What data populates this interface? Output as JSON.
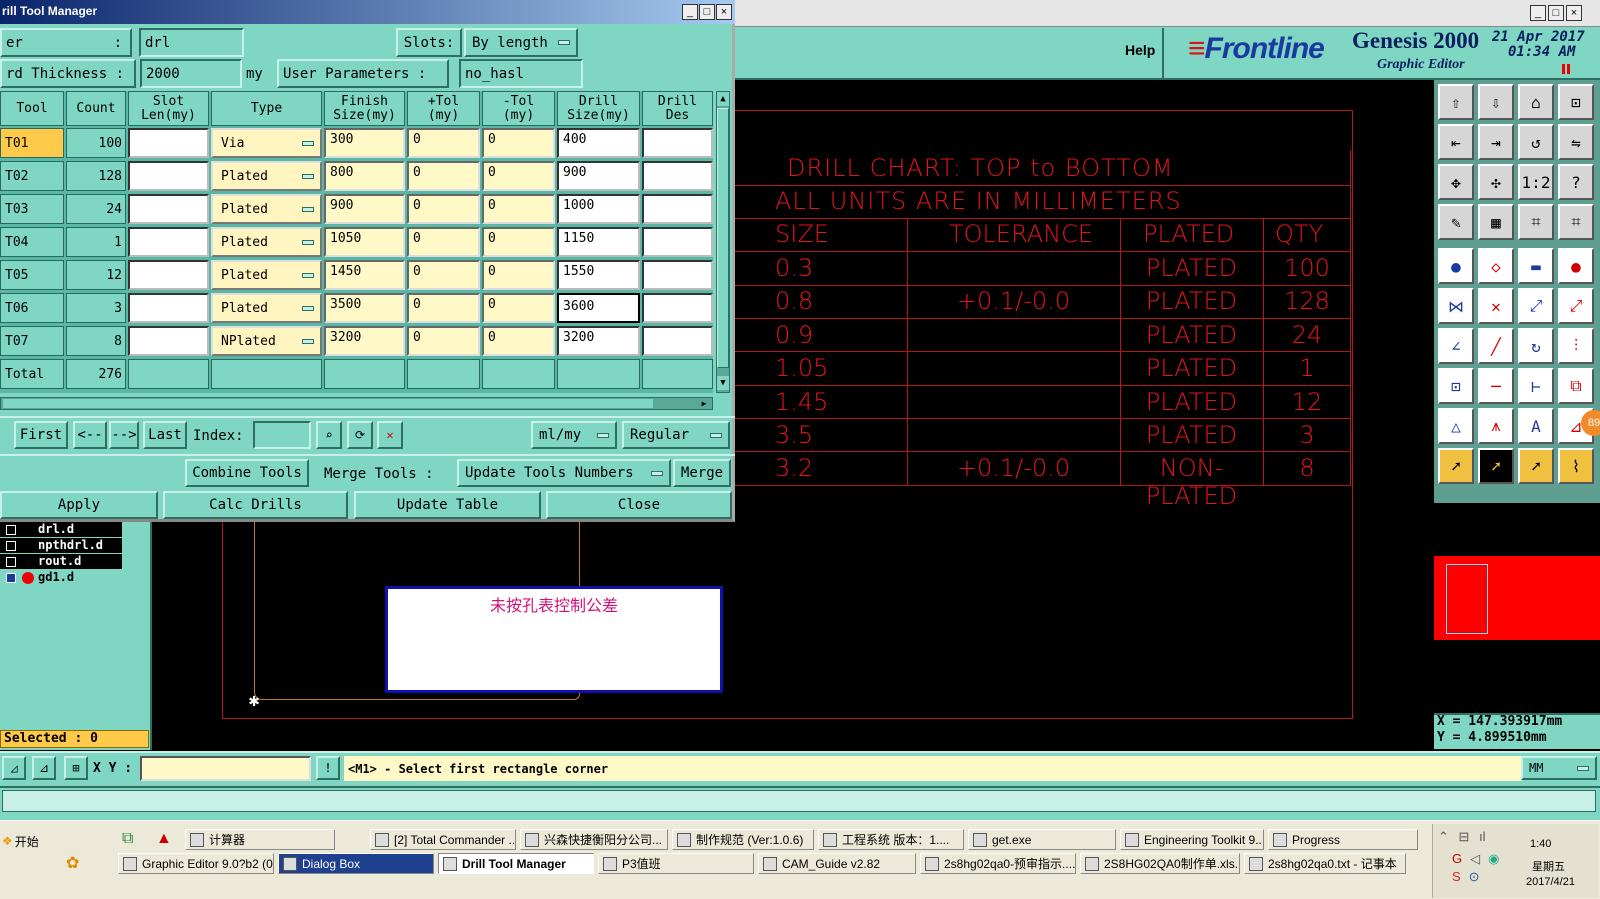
{
  "dialog": {
    "title": "rill Tool Manager",
    "window_controls": [
      "_",
      "□",
      "×"
    ],
    "layer_label": "er",
    "layer_sep": ":",
    "layer_value": "drl",
    "slots_label": "Slots:",
    "slots_value": "By length",
    "thickness_label": "rd Thickness :",
    "thickness_value": "2000",
    "thickness_unit": "my",
    "userparams_label": "User Parameters :",
    "userparams_value": "no_hasl",
    "columns": [
      "Tool",
      "Count",
      "Slot\nLen(my)",
      "Type",
      "Finish\nSize(my)",
      "+Tol\n(my)",
      "-Tol\n(my)",
      "Drill\nSize(my)",
      "Drill\nDes"
    ],
    "rows": [
      {
        "tool": "T01",
        "count": "100",
        "slot": "",
        "type": "Via",
        "finish": "300",
        "ptol": "0",
        "mtol": "0",
        "drill": "400",
        "des": ""
      },
      {
        "tool": "T02",
        "count": "128",
        "slot": "",
        "type": "Plated",
        "finish": "800",
        "ptol": "0",
        "mtol": "0",
        "drill": "900",
        "des": ""
      },
      {
        "tool": "T03",
        "count": "24",
        "slot": "",
        "type": "Plated",
        "finish": "900",
        "ptol": "0",
        "mtol": "0",
        "drill": "1000",
        "des": ""
      },
      {
        "tool": "T04",
        "count": "1",
        "slot": "",
        "type": "Plated",
        "finish": "1050",
        "ptol": "0",
        "mtol": "0",
        "drill": "1150",
        "des": ""
      },
      {
        "tool": "T05",
        "count": "12",
        "slot": "",
        "type": "Plated",
        "finish": "1450",
        "ptol": "0",
        "mtol": "0",
        "drill": "1550",
        "des": ""
      },
      {
        "tool": "T06",
        "count": "3",
        "slot": "",
        "type": "Plated",
        "finish": "3500",
        "ptol": "0",
        "mtol": "0",
        "drill": "3600",
        "des": ""
      },
      {
        "tool": "T07",
        "count": "8",
        "slot": "",
        "type": "NPlated",
        "finish": "3200",
        "ptol": "0",
        "mtol": "0",
        "drill": "3200",
        "des": ""
      }
    ],
    "total_label": "Total",
    "total_value": "276",
    "nav": {
      "first": "First",
      "prev": "<--",
      "next": "-->",
      "last": "Last",
      "index_label": "Index:",
      "index_value": "",
      "units": "ml/my",
      "mode": "Regular"
    },
    "combine": "Combine Tools",
    "merge_label": "Merge Tools :",
    "update_numbers": "Update Tools Numbers",
    "merge": "Merge",
    "apply": "Apply",
    "calc": "Calc Drills",
    "update_table": "Update Table",
    "close": "Close"
  },
  "editor": {
    "help": "Help",
    "brand": "Frontline",
    "app_name": "Genesis 2000",
    "subtitle": "Graphic Editor",
    "date": "21 Apr 2017",
    "time": "01:34 AM",
    "window_controls": [
      "_",
      "□",
      "×"
    ],
    "coord_x": "X = 147.393917mm",
    "coord_y": "Y = 4.899510mm",
    "units": "MM",
    "badge": "89",
    "xy_label": "X Y :",
    "xy_value": "",
    "status": "<M1> - Select first rectangle corner",
    "selected": "Selected : 0",
    "layers": [
      "drl.d",
      "npthdrl.d",
      "rout.d",
      "gd1.d"
    ],
    "note": "未按孔表控制公差"
  },
  "drill_chart": {
    "title": "DRILL CHART: TOP to BOTTOM",
    "units": "ALL UNITS ARE IN MILLIMETERS",
    "headers": [
      "SIZE",
      "TOLERANCE",
      "PLATED",
      "QTY"
    ],
    "rows": [
      {
        "size": "0.3",
        "tol": "",
        "plated": "PLATED",
        "qty": "100"
      },
      {
        "size": "0.8",
        "tol": "+0.1/-0.0",
        "plated": "PLATED",
        "qty": "128"
      },
      {
        "size": "0.9",
        "tol": "",
        "plated": "PLATED",
        "qty": "24"
      },
      {
        "size": "1.05",
        "tol": "",
        "plated": "PLATED",
        "qty": "1"
      },
      {
        "size": "1.45",
        "tol": "",
        "plated": "PLATED",
        "qty": "12"
      },
      {
        "size": "3.5",
        "tol": "",
        "plated": "PLATED",
        "qty": "3"
      },
      {
        "size": "3.2",
        "tol": "+0.1/-0.0",
        "plated": "NON-PLATED",
        "qty": "8"
      }
    ]
  },
  "taskbar": {
    "start": "开始",
    "row1": [
      "计算器",
      "[2] Total Commander ...",
      "兴森快捷衡阳分公司...",
      "制作规范 (Ver:1.0.6)",
      "工程系统 版本：1....",
      "get.exe",
      "Engineering Toolkit 9....",
      "Progress"
    ],
    "row2": [
      "Graphic Editor 9.0?b2 (0...",
      "Dialog Box",
      "Drill Tool Manager",
      "P3值班",
      "CAM_Guide v2.82",
      "2s8hg02qa0-预审指示....",
      "2S8HG02QA0制作单.xls...",
      "2s8hg02qa0.txt - 记事本"
    ],
    "clock": "1:40",
    "weekday": "星期五",
    "date": "2017/4/21"
  },
  "colors": {
    "teal": "#7fd6c3",
    "chart_red": "#e5141c",
    "selection": "#ffc94a",
    "brand_blue": "#1a3aa0"
  }
}
